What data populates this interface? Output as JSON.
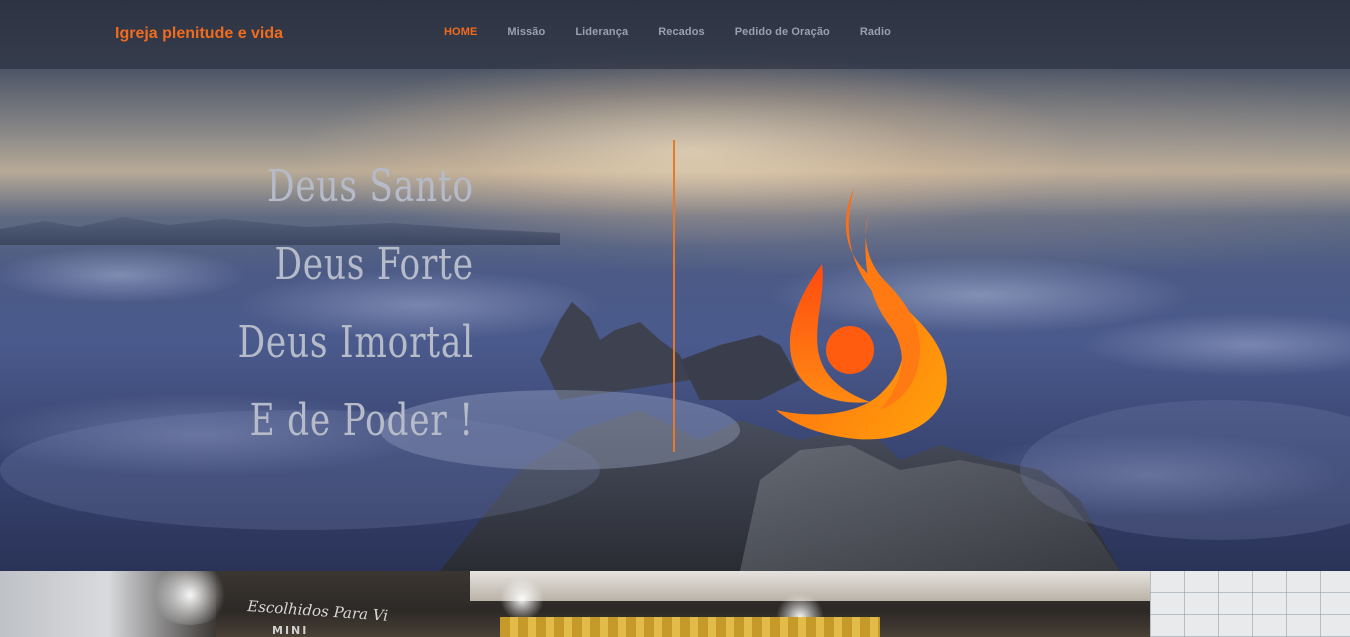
{
  "site": {
    "brand": "Igreja plenitude e vida",
    "accent_color": "#f26b1d"
  },
  "nav": {
    "items": [
      {
        "label": "HOME",
        "active": true
      },
      {
        "label": "Missão",
        "active": false
      },
      {
        "label": "Liderança",
        "active": false
      },
      {
        "label": "Recados",
        "active": false
      },
      {
        "label": "Pedido de Oração",
        "active": false
      },
      {
        "label": "Radio",
        "active": false
      }
    ]
  },
  "hero": {
    "lines": [
      "Deus Santo",
      "Deus Forte",
      "Deus Imortal",
      "E de Poder !"
    ],
    "logo_icon": "flame-person-icon",
    "background": "mountain-above-clouds-photo"
  },
  "photo_strip": {
    "wall_text": "Escolhidos Para Vi",
    "wall_text_2": "MINI"
  }
}
